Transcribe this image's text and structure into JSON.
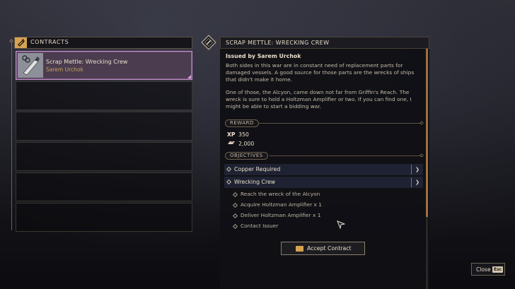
{
  "contracts": {
    "header": "CONTRACTS",
    "items": [
      {
        "title": "Scrap Mettle: Wrecking Crew",
        "issuer": "Sarem Urchok",
        "active": true
      }
    ],
    "empty_slot_count": 5
  },
  "detail": {
    "header": "SCRAP METTLE: WRECKING CREW",
    "issued_by": "Issued by Sarem Urchok",
    "description_1": "Both sides in this war are in constant need of replacement parts for damaged vessels. A good source for those parts are the wrecks of ships that didn't make it home.",
    "description_2": "One of those, the Alcyon, came down not far from Griffin's Reach. The wreck is sure to hold a Holtzman Amplifier or two. If you can find one, I might be able to start a bidding war.",
    "reward": {
      "label": "REWARD",
      "xp_key": "XP",
      "xp_value": "350",
      "currency_value": "2,000",
      "currency_icon": "solari-icon"
    },
    "objectives": {
      "label": "OBJECTIVES",
      "groups": [
        {
          "title": "Copper Required",
          "expanded": false
        },
        {
          "title": "Wrecking Crew",
          "expanded": true,
          "steps": [
            "Reach the wreck of the Alcyon",
            "Acquire Holtzman Amplifier x 1",
            "Deliver Holtzman Amplifier x 1",
            "Contact Issuer"
          ]
        }
      ]
    },
    "accept_label": "Accept Contract"
  },
  "footer": {
    "close_label": "Close",
    "close_key": "Esc"
  },
  "colors": {
    "accent_gold": "#d7a351",
    "active_purple": "#c28ecb",
    "panel_bg": "#101015"
  }
}
